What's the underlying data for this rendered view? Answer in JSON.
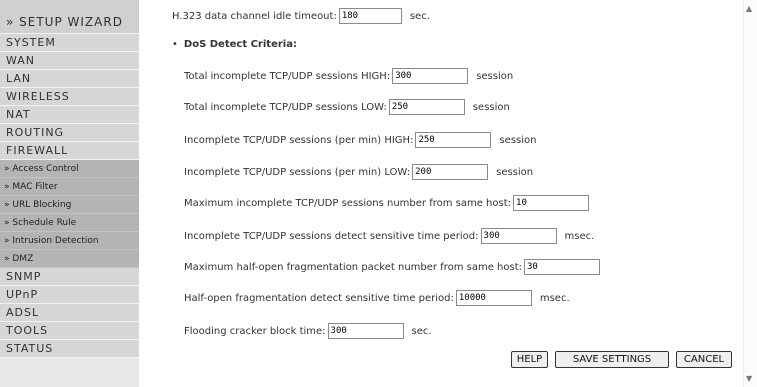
{
  "sidebar": {
    "setup_wizard": "» SETUP WIZARD",
    "items": [
      {
        "label": "SYSTEM"
      },
      {
        "label": "WAN"
      },
      {
        "label": "LAN"
      },
      {
        "label": "WIRELESS"
      },
      {
        "label": "NAT"
      },
      {
        "label": "ROUTING"
      },
      {
        "label": "FIREWALL"
      }
    ],
    "firewall_sub": [
      {
        "label": "» Access Control"
      },
      {
        "label": "» MAC Filter"
      },
      {
        "label": "» URL Blocking"
      },
      {
        "label": "» Schedule Rule"
      },
      {
        "label": "» Intrusion Detection"
      },
      {
        "label": "» DMZ"
      }
    ],
    "items_after": [
      {
        "label": "SNMP"
      },
      {
        "label": "UPnP"
      },
      {
        "label": "ADSL"
      },
      {
        "label": "TOOLS"
      },
      {
        "label": "STATUS"
      }
    ]
  },
  "content": {
    "h323": {
      "label": "H.323 data channel idle timeout:",
      "value": "180",
      "unit": "sec."
    },
    "section_title": "DoS Detect Criteria:",
    "section_bullet": "•",
    "fields": [
      {
        "label": "Total incomplete TCP/UDP sessions HIGH:",
        "value": "300",
        "unit": "session"
      },
      {
        "label": "Total incomplete TCP/UDP sessions LOW:",
        "value": "250",
        "unit": "session"
      },
      {
        "label": "Incomplete TCP/UDP sessions (per min) HIGH:",
        "value": "250",
        "unit": "session"
      },
      {
        "label": "Incomplete TCP/UDP sessions (per min) LOW:",
        "value": "200",
        "unit": "session"
      },
      {
        "label": "Maximum incomplete TCP/UDP sessions number from same host:",
        "value": "10",
        "unit": ""
      },
      {
        "label": "Incomplete TCP/UDP sessions detect sensitive time period:",
        "value": "300",
        "unit": "msec."
      },
      {
        "label": "Maximum half-open fragmentation packet number from same host:",
        "value": "30",
        "unit": ""
      },
      {
        "label": "Half-open fragmentation detect sensitive time period:",
        "value": "10000",
        "unit": "msec."
      },
      {
        "label": "Flooding cracker block time:",
        "value": "300",
        "unit": "sec."
      }
    ],
    "buttons": {
      "help": "HELP",
      "save": "SAVE SETTINGS",
      "cancel": "CANCEL"
    }
  },
  "scrollbar": {
    "up_icon": "triangle-up-icon",
    "down_icon": "triangle-down-icon"
  }
}
